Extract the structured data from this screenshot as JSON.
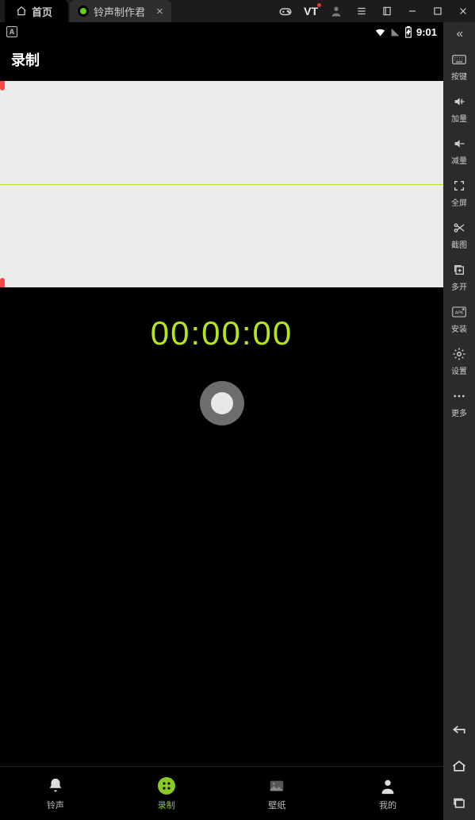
{
  "emulator": {
    "home_label": "首页",
    "app_tab_label": "铃声制作君",
    "vt_label": "VT"
  },
  "status": {
    "clock": "9:01"
  },
  "app": {
    "header_title": "录制",
    "timer": "00:00:00"
  },
  "tabs": {
    "ringtone": "铃声",
    "record": "录制",
    "wallpaper": "壁纸",
    "mine": "我的"
  },
  "sidebar": {
    "keys": "按键",
    "volup": "加量",
    "voldown": "减量",
    "fullscreen": "全屏",
    "screenshot": "截图",
    "multi": "多开",
    "install": "安装",
    "settings": "设置",
    "more": "更多"
  },
  "colors": {
    "accent": "#b5e61d"
  }
}
